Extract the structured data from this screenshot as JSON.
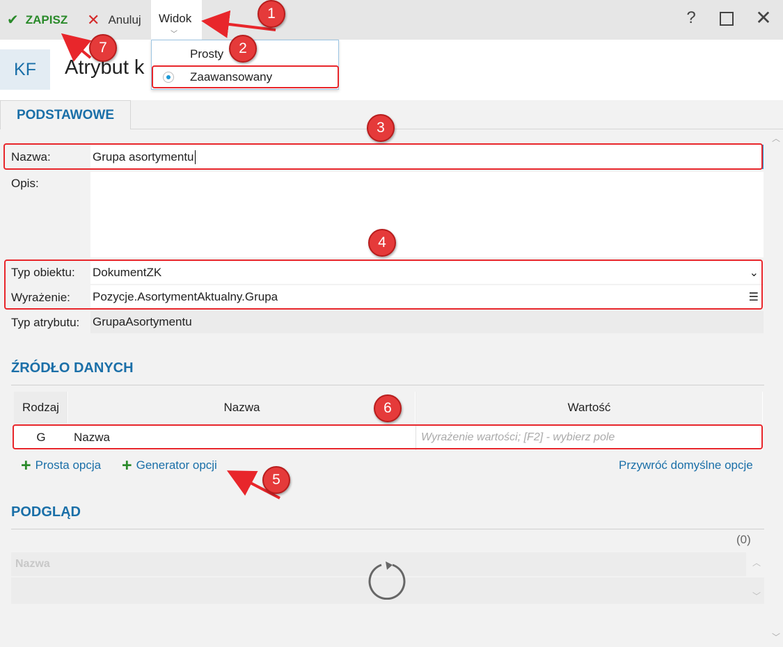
{
  "toolbar": {
    "save_label": "ZAPISZ",
    "cancel_label": "Anuluj",
    "view_label": "Widok",
    "help_icon": "question-icon",
    "maximize_icon": "maximize-icon",
    "close_icon": "close-icon"
  },
  "header": {
    "badge": "KF",
    "title": "Atrybut k"
  },
  "view_menu": {
    "items": [
      {
        "label": "Prosty",
        "selected": false
      },
      {
        "label": "Zaawansowany",
        "selected": true
      }
    ]
  },
  "tabs": [
    {
      "label": "PODSTAWOWE",
      "active": true
    }
  ],
  "form": {
    "name_label": "Nazwa:",
    "name_value": "Grupa asortymentu",
    "desc_label": "Opis:",
    "desc_value": "",
    "object_type_label": "Typ obiektu:",
    "object_type_value": "DokumentZK",
    "expression_label": "Wyrażenie:",
    "expression_value": "Pozycje.AsortymentAktualny.Grupa",
    "attr_type_label": "Typ atrybutu:",
    "attr_type_value": "GrupaAsortymentu"
  },
  "data_source": {
    "heading": "ŹRÓDŁO DANYCH",
    "columns": [
      "Rodzaj",
      "Nazwa",
      "Wartość"
    ],
    "rows": [
      {
        "kind": "G",
        "name": "Nazwa",
        "value_placeholder": "Wyrażenie wartości; [F2] - wybierz pole"
      }
    ],
    "add_simple_label": "Prosta opcja",
    "add_generator_label": "Generator opcji",
    "restore_label": "Przywróć domyślne opcje"
  },
  "preview": {
    "heading": "PODGLĄD",
    "count": "(0)",
    "column": "Nazwa"
  },
  "annotations": {
    "badges": [
      "1",
      "2",
      "3",
      "4",
      "5",
      "6",
      "7"
    ],
    "color": "#e53a3a"
  }
}
